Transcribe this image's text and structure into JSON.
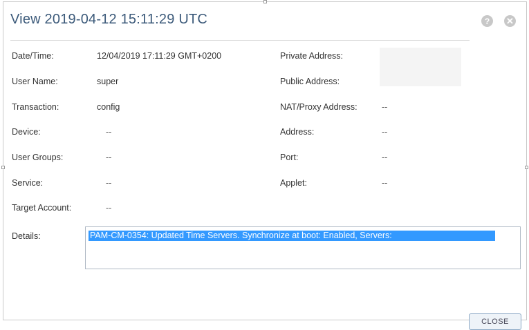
{
  "dialog": {
    "title": "View 2019-04-12 15:11:29 UTC",
    "help_icon": "?",
    "close_icon": "✕"
  },
  "left_fields": [
    {
      "label": "Date/Time:",
      "value": "12/04/2019 17:11:29 GMT+0200"
    },
    {
      "label": "User Name:",
      "value": "super"
    },
    {
      "label": "Transaction:",
      "value": "config"
    },
    {
      "label": "Device:",
      "value": "--"
    },
    {
      "label": "User Groups:",
      "value": "--"
    },
    {
      "label": "Service:",
      "value": "--"
    },
    {
      "label": "Target Account:",
      "value": "--"
    }
  ],
  "right_fields": [
    {
      "label": "Private Address:",
      "value": ""
    },
    {
      "label": "Public Address:",
      "value": ""
    },
    {
      "label": "NAT/Proxy Address:",
      "value": "--"
    },
    {
      "label": "Address:",
      "value": "--"
    },
    {
      "label": "Port:",
      "value": "--"
    },
    {
      "label": "Applet:",
      "value": "--"
    }
  ],
  "details": {
    "label": "Details:",
    "text": "PAM-CM-0354: Updated Time Servers. Synchronize at boot: Enabled, Servers:"
  },
  "footer": {
    "close_label": "CLOSE"
  },
  "colors": {
    "title": "#3c5a7a",
    "selection": "#3399ff",
    "icon_gray": "#c8c8c8"
  }
}
